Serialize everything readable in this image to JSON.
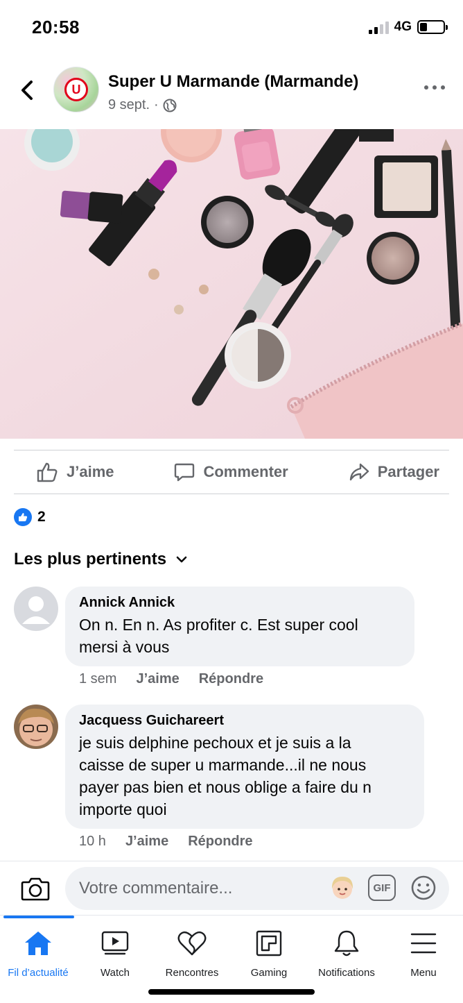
{
  "status_bar": {
    "time": "20:58",
    "network": "4G"
  },
  "post": {
    "page_name": "Super U Marmande (Marmande)",
    "date": "9 sept.",
    "separator": "·",
    "avatar_logo_letter": "U",
    "image_description_icon": "makeup-products-photo"
  },
  "actions": {
    "like_label": "J’aime",
    "comment_label": "Commenter",
    "share_label": "Partager"
  },
  "reactions": {
    "count": "2"
  },
  "sort": {
    "label": "Les plus pertinents"
  },
  "comments": [
    {
      "author": "Annick Annick",
      "text_line1": "On n. En  n. As profiter c. Est super cool",
      "text_line2": "mersi à vous",
      "time": "1 sem",
      "like": "J’aime",
      "reply": "Répondre"
    },
    {
      "author": "Jacquess Guichareert",
      "text_line1": "je suis delphine pechoux et je suis a la",
      "text_line2": "caisse de super u marmande...il ne nous",
      "text_line3": "payer pas bien et nous oblige a faire du n",
      "text_line4": "importe quoi",
      "time": "10 h",
      "like": "J’aime",
      "reply": "Répondre"
    }
  ],
  "composer": {
    "placeholder": "Votre commentaire...",
    "gif_label": "GIF"
  },
  "tabs": [
    {
      "label": "Fil d’actualité",
      "icon": "home-icon",
      "active": true
    },
    {
      "label": "Watch",
      "icon": "watch-icon"
    },
    {
      "label": "Rencontres",
      "icon": "dating-heart-icon"
    },
    {
      "label": "Gaming",
      "icon": "gaming-icon"
    },
    {
      "label": "Notifications",
      "icon": "bell-icon"
    },
    {
      "label": "Menu",
      "icon": "menu-icon"
    }
  ],
  "colors": {
    "accent": "#1877f2",
    "secondary_text": "#65676b",
    "bubble": "#f0f2f5",
    "brand_red": "#e2001a"
  }
}
